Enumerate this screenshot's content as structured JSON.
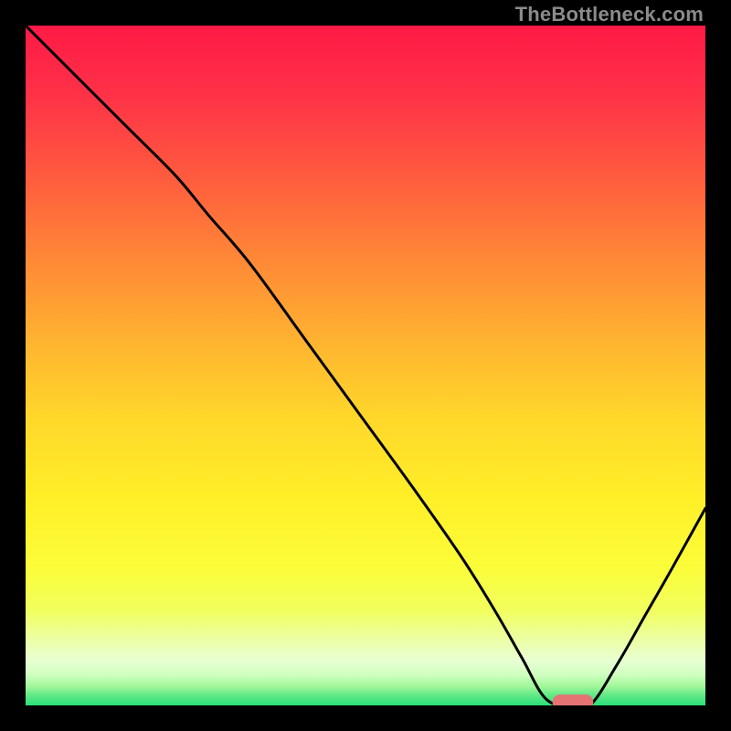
{
  "watermark": "TheBottleneck.com",
  "chart_data": {
    "type": "line",
    "title": "",
    "xlabel": "",
    "ylabel": "",
    "xlim": [
      0,
      100
    ],
    "ylim": [
      0,
      100
    ],
    "grid": false,
    "legend": false,
    "gradient_stops": [
      {
        "offset": 0.0,
        "color": "#ff1a46"
      },
      {
        "offset": 0.1,
        "color": "#ff3148"
      },
      {
        "offset": 0.22,
        "color": "#ff5a3e"
      },
      {
        "offset": 0.35,
        "color": "#ff8a36"
      },
      {
        "offset": 0.47,
        "color": "#ffb530"
      },
      {
        "offset": 0.58,
        "color": "#ffd82a"
      },
      {
        "offset": 0.7,
        "color": "#fff028"
      },
      {
        "offset": 0.8,
        "color": "#fbfd3a"
      },
      {
        "offset": 0.86,
        "color": "#f1ff5e"
      },
      {
        "offset": 0.905,
        "color": "#ecffa8"
      },
      {
        "offset": 0.935,
        "color": "#e8ffd3"
      },
      {
        "offset": 0.955,
        "color": "#cfffbf"
      },
      {
        "offset": 0.972,
        "color": "#a1f79a"
      },
      {
        "offset": 0.985,
        "color": "#61e886"
      },
      {
        "offset": 1.0,
        "color": "#2ae07a"
      }
    ],
    "series": [
      {
        "name": "bottleneck-curve",
        "x": [
          0,
          8,
          15,
          22,
          27,
          33,
          41,
          49,
          57,
          64,
          69,
          73,
          76.5,
          80,
          83,
          87,
          91,
          95,
          100
        ],
        "y": [
          100,
          92,
          85,
          78,
          72,
          65,
          54,
          43,
          32,
          22,
          14,
          7,
          1,
          0,
          0,
          6,
          13,
          20,
          29
        ]
      }
    ],
    "marker": {
      "name": "optimal-range",
      "x_start": 77.5,
      "x_end": 83.5,
      "y": 0.5,
      "color": "#e57373",
      "height": 2.2
    }
  }
}
